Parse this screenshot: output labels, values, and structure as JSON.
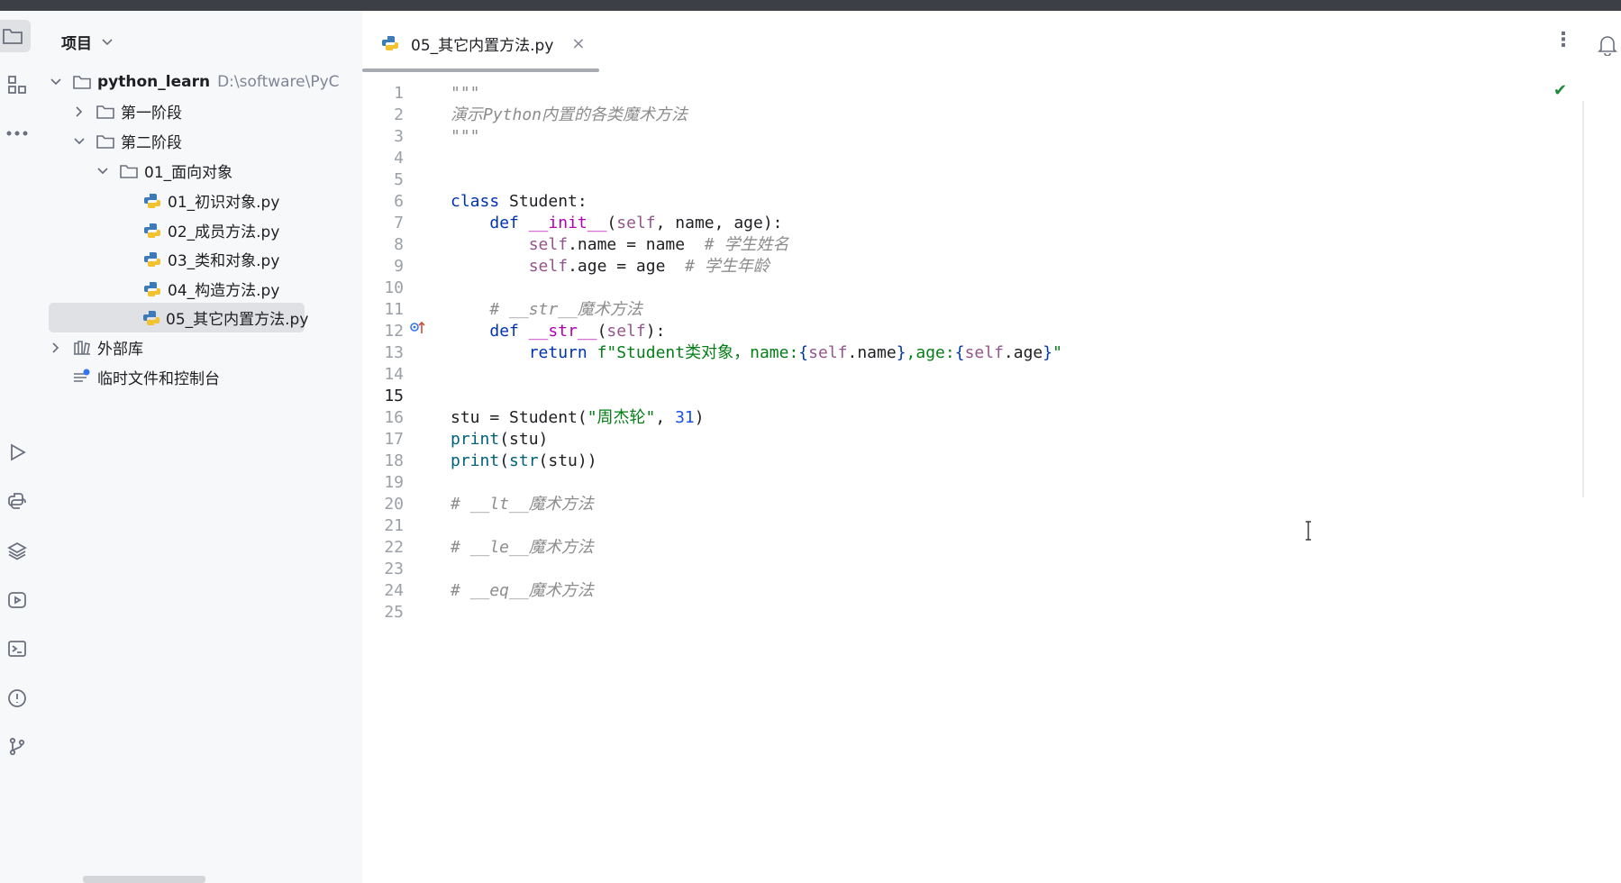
{
  "project_panel": {
    "title": "项目",
    "tree": [
      {
        "label": "python_learn",
        "hint": "D:\\software\\PyC",
        "type": "folder",
        "expanded": true
      },
      {
        "label": "第一阶段",
        "type": "folder",
        "expanded": false
      },
      {
        "label": "第二阶段",
        "type": "folder",
        "expanded": true
      },
      {
        "label": "01_面向对象",
        "type": "folder",
        "expanded": true
      },
      {
        "label": "01_初识对象.py",
        "type": "python-file"
      },
      {
        "label": "02_成员方法.py",
        "type": "python-file"
      },
      {
        "label": "03_类和对象.py",
        "type": "python-file"
      },
      {
        "label": "04_构造方法.py",
        "type": "python-file"
      },
      {
        "label": "05_其它内置方法.py",
        "type": "python-file",
        "selected": true
      },
      {
        "label": "外部库",
        "type": "library",
        "expanded": false
      },
      {
        "label": "临时文件和控制台",
        "type": "scratches"
      }
    ]
  },
  "editor": {
    "tab_label": "05_其它内置方法.py",
    "tab_close": "×",
    "current_line": 15,
    "lines": [
      [
        {
          "t": "\"\"\"",
          "c": "cmt"
        }
      ],
      [
        {
          "t": "演示Python内置的各类魔术方法",
          "c": "cmt"
        }
      ],
      [
        {
          "t": "\"\"\"",
          "c": "cmt"
        }
      ],
      [],
      [],
      [
        {
          "t": "class",
          "c": "kw"
        },
        {
          "t": " Student:"
        }
      ],
      [
        {
          "t": "    "
        },
        {
          "t": "def",
          "c": "kw"
        },
        {
          "t": " "
        },
        {
          "t": "__init__",
          "c": "dunder"
        },
        {
          "t": "("
        },
        {
          "t": "self",
          "c": "selfc"
        },
        {
          "t": ", name, age):"
        }
      ],
      [
        {
          "t": "        "
        },
        {
          "t": "self",
          "c": "selfc"
        },
        {
          "t": ".name = name  "
        },
        {
          "t": "# 学生姓名",
          "c": "cmt"
        }
      ],
      [
        {
          "t": "        "
        },
        {
          "t": "self",
          "c": "selfc"
        },
        {
          "t": ".age = age  "
        },
        {
          "t": "# 学生年龄",
          "c": "cmt"
        }
      ],
      [],
      [
        {
          "t": "    "
        },
        {
          "t": "# __str__魔术方法",
          "c": "cmt"
        }
      ],
      [
        {
          "t": "    "
        },
        {
          "t": "def",
          "c": "kw"
        },
        {
          "t": " "
        },
        {
          "t": "__str__",
          "c": "dunder"
        },
        {
          "t": "("
        },
        {
          "t": "self",
          "c": "selfc"
        },
        {
          "t": "):"
        }
      ],
      [
        {
          "t": "        "
        },
        {
          "t": "return",
          "c": "kw"
        },
        {
          "t": " "
        },
        {
          "t": "f\"Student类对象，name:",
          "c": "str"
        },
        {
          "t": "{",
          "c": "brace"
        },
        {
          "t": "self",
          "c": "selfc"
        },
        {
          "t": ".name"
        },
        {
          "t": "}",
          "c": "brace"
        },
        {
          "t": ",age:",
          "c": "str"
        },
        {
          "t": "{",
          "c": "brace"
        },
        {
          "t": "self",
          "c": "selfc"
        },
        {
          "t": ".age"
        },
        {
          "t": "}",
          "c": "brace"
        },
        {
          "t": "\"",
          "c": "str"
        }
      ],
      [],
      [],
      [
        {
          "t": "stu = Student("
        },
        {
          "t": "\"周杰轮\"",
          "c": "str"
        },
        {
          "t": ", "
        },
        {
          "t": "31",
          "c": "num"
        },
        {
          "t": ")"
        }
      ],
      [
        {
          "t": "print",
          "c": "fn"
        },
        {
          "t": "(stu)"
        }
      ],
      [
        {
          "t": "print",
          "c": "fn"
        },
        {
          "t": "("
        },
        {
          "t": "str",
          "c": "fn"
        },
        {
          "t": "(stu))"
        }
      ],
      [],
      [
        {
          "t": "# __lt__魔术方法",
          "c": "cmt"
        }
      ],
      [],
      [
        {
          "t": "# __le__魔术方法",
          "c": "cmt"
        }
      ],
      [],
      [
        {
          "t": "# __eq__魔术方法",
          "c": "cmt"
        }
      ],
      []
    ]
  },
  "icons": {
    "toolstrip": [
      "project-folder-icon",
      "structure-icon",
      "more-tools-icon",
      "run-icon",
      "python-console-icon",
      "layers-icon",
      "services-icon",
      "terminal-icon",
      "problems-icon",
      "git-icon"
    ],
    "status_check": "✔"
  },
  "colors": {
    "keyword": "#0033b3",
    "dunder": "#b200b2",
    "self": "#94558d",
    "string": "#067d17",
    "number": "#1750eb",
    "comment": "#8c8c8c"
  }
}
